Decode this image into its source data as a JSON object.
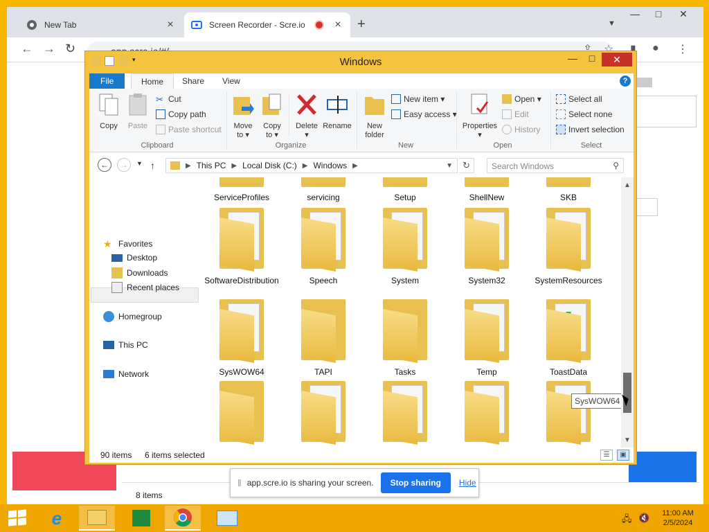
{
  "browser": {
    "tabs": [
      {
        "label": "New Tab"
      },
      {
        "label": "Screen Recorder - Scre.io"
      }
    ],
    "url": "app.scre.io/#/",
    "icons": [
      "chrome-icon",
      "recording-icon",
      "back-icon",
      "forward-icon",
      "reload-icon",
      "lock-icon",
      "share-icon",
      "star-icon",
      "profile-icon",
      "menu-icon"
    ],
    "window_controls": {
      "minimize": "—",
      "maximize": "□",
      "close": "✕"
    }
  },
  "background_page": {
    "items_count": "8 items"
  },
  "explorer": {
    "title": "Windows",
    "ribbon_tabs": [
      "File",
      "Home",
      "Share",
      "View"
    ],
    "ribbon": {
      "clipboard": {
        "label": "Clipboard",
        "copy": "Copy",
        "paste": "Paste",
        "cut": "Cut",
        "copy_path": "Copy path",
        "paste_shortcut": "Paste shortcut"
      },
      "organize": {
        "label": "Organize",
        "move_to": "Move",
        "move_to_2": "to ▾",
        "copy_to": "Copy",
        "copy_to_2": "to ▾",
        "delete": "Delete",
        "delete_2": "▾",
        "rename": "Rename"
      },
      "new": {
        "label": "New",
        "new_folder": "New",
        "new_folder_2": "folder",
        "new_item": "New item ▾",
        "easy_access": "Easy access ▾"
      },
      "open": {
        "label": "Open",
        "properties": "Properties",
        "properties_2": "▾",
        "open": "Open ▾",
        "edit": "Edit",
        "history": "History"
      },
      "select": {
        "label": "Select",
        "select_all": "Select all",
        "select_none": "Select none",
        "invert_selection": "Invert selection"
      }
    },
    "address": {
      "segments": [
        "This PC",
        "Local Disk (C:)",
        "Windows"
      ],
      "search_placeholder": "Search Windows"
    },
    "nav": {
      "favorites": "Favorites",
      "desktop": "Desktop",
      "downloads": "Downloads",
      "recent_places": "Recent places",
      "homegroup": "Homegroup",
      "this_pc": "This PC",
      "network": "Network"
    },
    "folders_row1": [
      "ServiceProfiles",
      "servicing",
      "Setup",
      "ShellNew",
      "SKB"
    ],
    "folders_row2": [
      "SoftwareDistribution",
      "Speech",
      "System",
      "System32",
      "SystemResources"
    ],
    "folders_row3": [
      "SysWOW64",
      "TAPI",
      "Tasks",
      "Temp",
      "ToastData"
    ],
    "tooltip": "SysWOW64",
    "status": {
      "items": "90 items",
      "selected": "6 items selected"
    }
  },
  "sharebar": {
    "message": "app.scre.io is sharing your screen.",
    "stop": "Stop sharing",
    "hide": "Hide"
  },
  "taskbar": {
    "time": "11:00 AM",
    "date": "2/5/2024",
    "apps": [
      "start-icon",
      "internet-explorer-icon",
      "file-explorer-icon",
      "store-icon",
      "chrome-icon",
      "remote-desktop-icon"
    ]
  },
  "colors": {
    "accent": "#1979ca",
    "taskbar": "#f0a600",
    "window_border": "#f5c33e",
    "close": "#c7312a",
    "share_button": "#1a73e8"
  }
}
